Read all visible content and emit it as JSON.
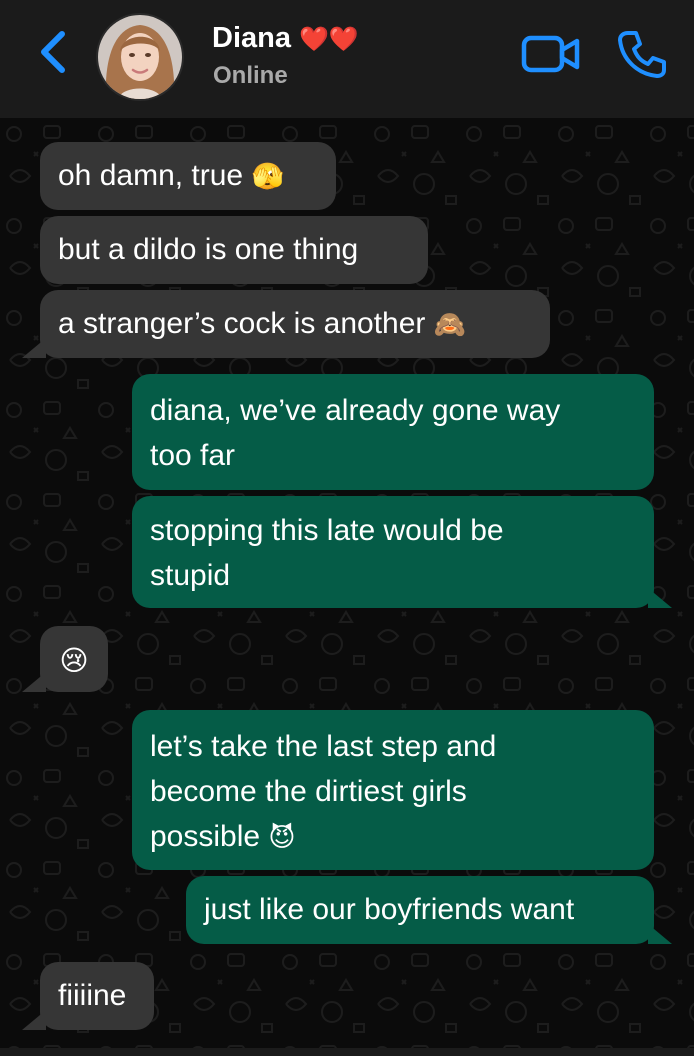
{
  "header": {
    "name": "Diana",
    "hearts": "❤️❤️",
    "status": "Online"
  },
  "colors": {
    "accent": "#1f8fff",
    "incoming_bubble": "#363636",
    "outgoing_bubble": "#055c47",
    "header_bg": "#1b1b1b",
    "chat_bg": "#0b0b0b"
  },
  "messages": [
    {
      "direction": "incoming",
      "text": "oh damn, true",
      "emoji": "🫣"
    },
    {
      "direction": "incoming",
      "text": "but a dildo is one thing"
    },
    {
      "direction": "incoming",
      "text": "a stranger’s cock is another",
      "emoji": "🙈"
    },
    {
      "direction": "outgoing",
      "line1": "diana, we’ve already gone way",
      "line2": "too far"
    },
    {
      "direction": "outgoing",
      "line1": "stopping this late would be",
      "line2": "stupid"
    },
    {
      "direction": "incoming",
      "emoji": "😢"
    },
    {
      "direction": "outgoing",
      "line1": "let’s take the last step and",
      "line2": "become the dirtiest girls",
      "line3": "possible",
      "emoji": "😈"
    },
    {
      "direction": "outgoing",
      "text": "just like our boyfriends want"
    },
    {
      "direction": "incoming",
      "text": "fiiiine"
    }
  ]
}
